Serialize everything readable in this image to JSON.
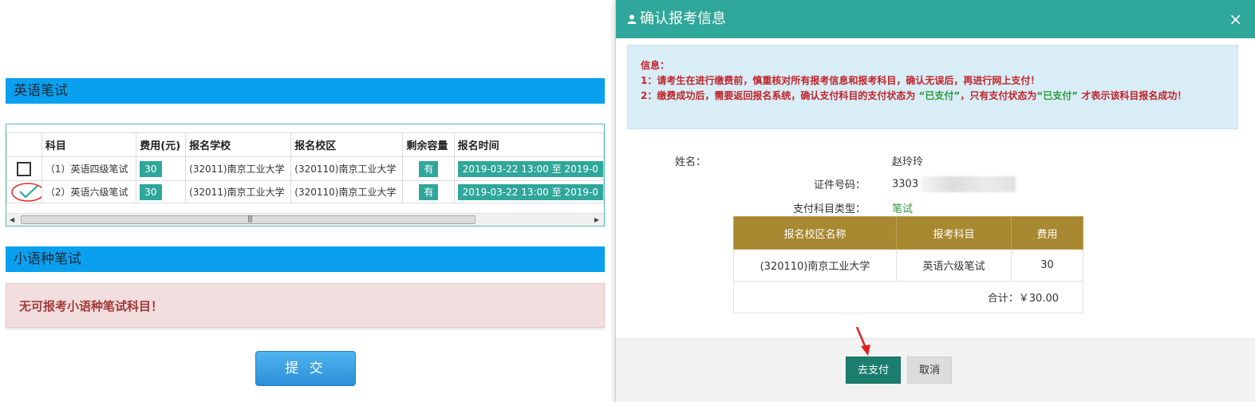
{
  "left": {
    "section_english": "英语笔试",
    "section_minor": "小语种笔试",
    "table": {
      "headers": [
        "",
        "科目",
        "费用(元)",
        "报名学校",
        "报名校区",
        "剩余容量",
        "报名时间"
      ],
      "rows": [
        {
          "subject": "（1）英语四级笔试",
          "fee": "30",
          "school": "(32011)南京工业大学",
          "campus": "(320110)南京工业大学",
          "capacity": "有",
          "time": "2019-03-22 13:00 至 2019-0",
          "checked": false
        },
        {
          "subject": "（2）英语六级笔试",
          "fee": "30",
          "school": "(32011)南京工业大学",
          "campus": "(320110)南京工业大学",
          "capacity": "有",
          "time": "2019-03-22 13:00 至 2019-0",
          "checked": true
        }
      ]
    },
    "alert_text": "无可报考小语种笔试科目！",
    "submit_label": "提 交"
  },
  "modal": {
    "title": "确认报考信息",
    "close_glyph": "×",
    "info": {
      "heading": "信息：",
      "line1": "1：请考生在进行缴费前，慎重核对所有报考信息和报考科目，确认无误后，再进行网上支付！",
      "line2_a": "2：缴费成功后，需要返回报名系统，确认支付科目的支付状态为",
      "paid1": "“已支付”",
      "line2_b": "，只有支付状态为",
      "paid2": "“已支付”",
      "line2_c": "才表示该科目报名成功！"
    },
    "form": {
      "name_label": "姓名：",
      "name_value": "赵玲玲",
      "id_label": "证件号码：",
      "id_value": "3303",
      "type_label": "支付科目类型：",
      "type_value": "笔试"
    },
    "pay_table": {
      "headers": [
        "报名校区名称",
        "报考科目",
        "费用"
      ],
      "row": [
        "(320110)南京工业大学",
        "英语六级笔试",
        "30"
      ],
      "total": "合计：￥30.00"
    },
    "pay_button": "去支付",
    "cancel_button": "取消"
  },
  "colors": {
    "section_bar": "#0aa0f0",
    "teal": "#2fa79a",
    "gold_header": "#a88830",
    "alert_bg": "#f2dede",
    "info_bg": "#d9edf7"
  }
}
